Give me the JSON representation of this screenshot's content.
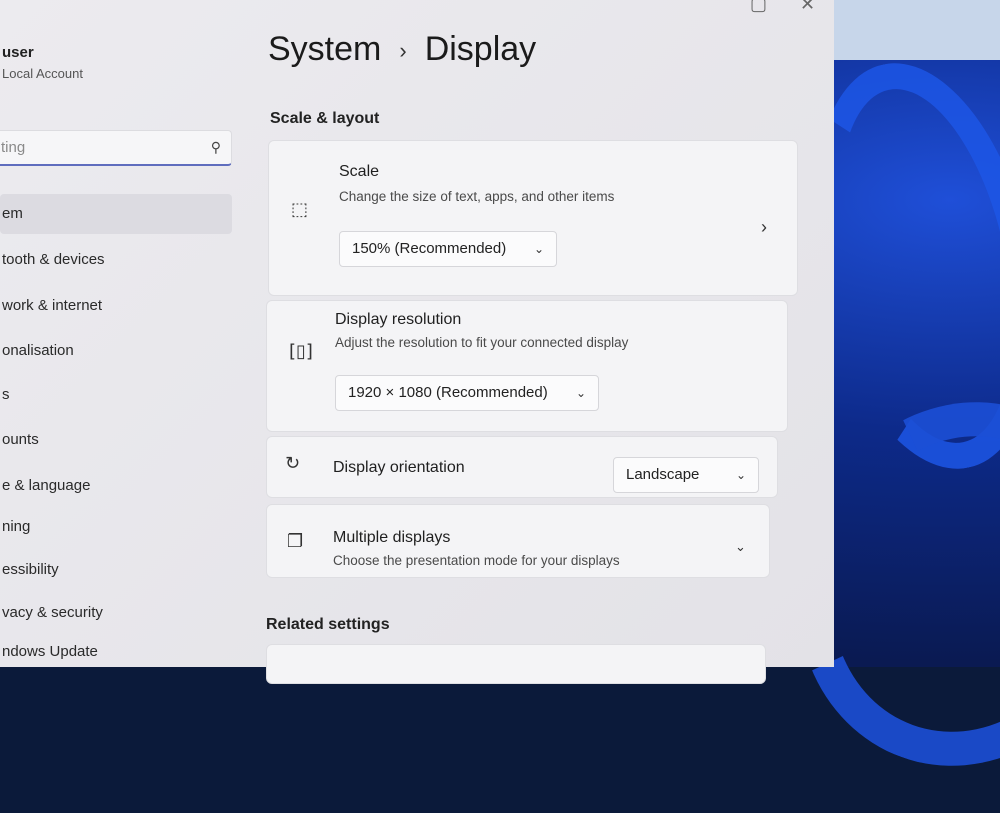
{
  "window": {
    "controls": {
      "minimize": "▢",
      "close": "✕"
    }
  },
  "user": {
    "name": "user",
    "account": "Local Account"
  },
  "search": {
    "placeholder": "ting"
  },
  "sidebar": {
    "items": [
      {
        "label": "em",
        "active": true
      },
      {
        "label": "tooth & devices"
      },
      {
        "label": "work & internet"
      },
      {
        "label": "onalisation"
      },
      {
        "label": "s"
      },
      {
        "label": "ounts"
      },
      {
        "label": "e & language"
      },
      {
        "label": "ning"
      },
      {
        "label": "essibility"
      },
      {
        "label": "vacy & security"
      },
      {
        "label": "ndows Update"
      }
    ]
  },
  "breadcrumb": {
    "parent": "System",
    "separator": "›",
    "current": "Display"
  },
  "sections": {
    "scale_layout": "Scale & layout",
    "related": "Related settings"
  },
  "cards": {
    "scale": {
      "title": "Scale",
      "subtitle": "Change the size of text, apps, and other items",
      "value": "150% (Recommended)"
    },
    "resolution": {
      "title": "Display resolution",
      "subtitle": "Adjust the resolution to fit your connected display",
      "value": "1920 × 1080 (Recommended)"
    },
    "orientation": {
      "title": "Display orientation",
      "value": "Landscape"
    },
    "multiple": {
      "title": "Multiple displays",
      "subtitle": "Choose the presentation mode for your displays"
    }
  },
  "icons": {
    "search": "search-icon",
    "scale": "scale-icon",
    "resolution": "resolution-icon",
    "orientation": "orientation-icon",
    "multiple": "multiple-displays-icon",
    "chevron_down": "chevron-down-icon",
    "chevron_right": "chevron-right-icon"
  },
  "colors": {
    "accent": "#5f6dbe",
    "window_bg": "#ecebef",
    "card_bg": "#f4f4f6"
  }
}
